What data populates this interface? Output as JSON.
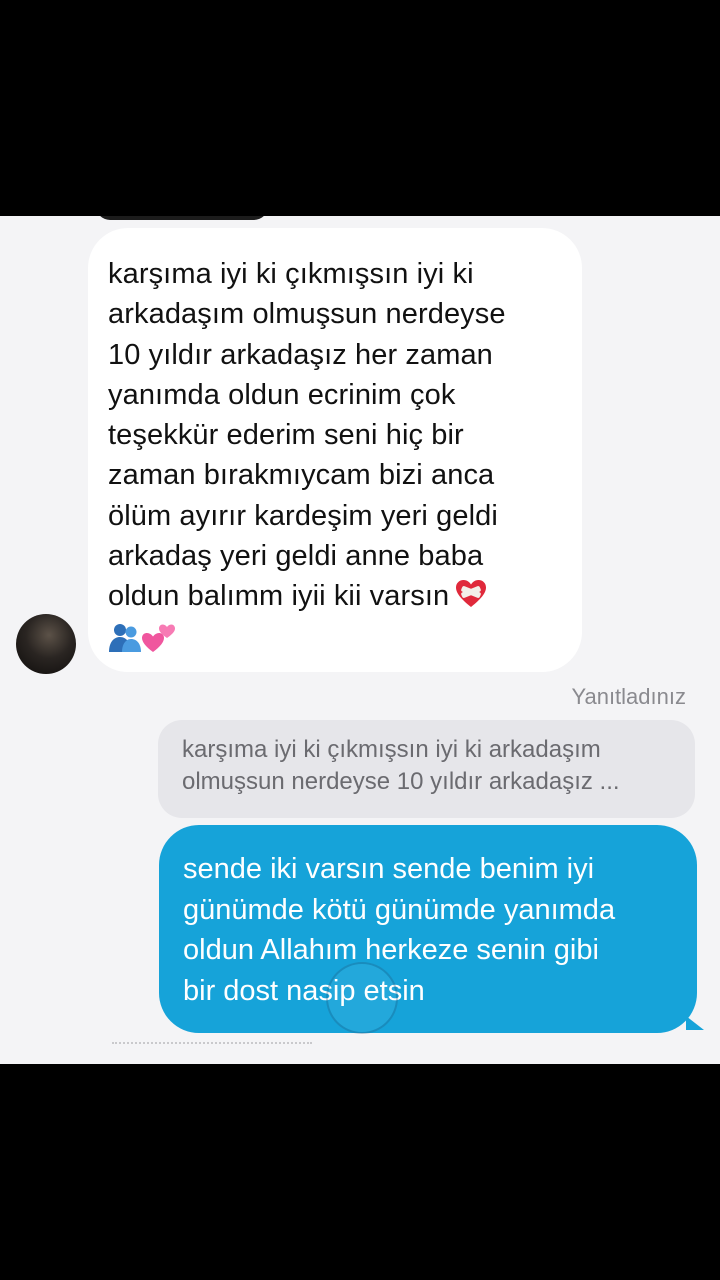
{
  "conversation": {
    "incoming_message": {
      "text": "karşıma iyi ki çıkmışsın iyi ki\narkadaşım olmuşsun nerdeyse\n10 yıldır arkadaşız her zaman\nyanımda oldun ecrinim çok\nteşekkür ederim seni hiç bir\nzaman bırakmıycam bizi anca\nölüm ayırır kardeşim yeri geldi\narkadaş yeri geldi anne baba\noldun balımm iyii kii varsın",
      "emojis": [
        "mending-heart-emoji",
        "people-hugging-emoji",
        "two-hearts-emoji"
      ]
    },
    "reply_indicator": "Yanıtladınız",
    "quoted_message": "karşıma iyi ki çıkmışsın iyi ki arkadaşım\nolmuşsun nerdeyse 10 yıldır arkadaşız ...",
    "outgoing_message": {
      "text": "sende iki varsın sende benim iyi\ngünümde kötü günümde yanımda\noldun Allahım herkeze senin gibi\nbir dost nasip etsin"
    }
  },
  "colors": {
    "outgoing_bubble": "#16a3d9",
    "incoming_bubble": "#ffffff",
    "chat_background": "#f4f4f6",
    "quote_bubble": "#e6e6ea"
  }
}
